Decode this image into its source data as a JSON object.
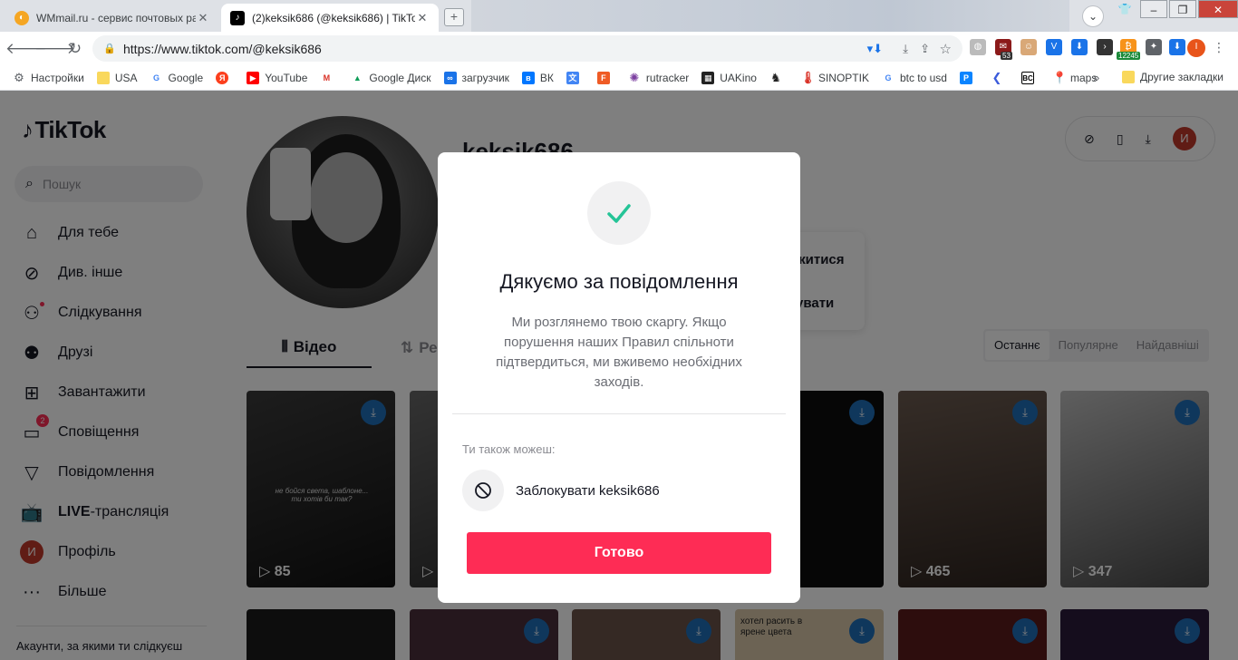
{
  "browser": {
    "tabs": [
      {
        "title": "WMmail.ru - сервис почтовых ра",
        "active": false
      },
      {
        "title": "(2)keksik686 (@keksik686) | TikTok",
        "active": true
      }
    ],
    "address": "https://www.tiktok.com/@keksik686",
    "extension_badges": {
      "mail_count": "53",
      "price": "12245"
    },
    "profile_initial": "I",
    "bookmarks": [
      "Настройки",
      "USA",
      "Google",
      "Я",
      "YouTube",
      "Google Диск",
      "загрузчик",
      "ВК",
      "rutracker",
      "UAKino",
      "SINOPTIK",
      "btc to usd",
      "maps"
    ],
    "bookmarks_more": "»",
    "bookmarks_other": "Другие закладки"
  },
  "tiktok": {
    "logo": "TikTok",
    "search_placeholder": "Пошук",
    "nav": [
      {
        "label": "Для тебе",
        "icon": "home-icon"
      },
      {
        "label": "Див. інше",
        "icon": "compass-icon"
      },
      {
        "label": "Слідкування",
        "icon": "following-icon"
      },
      {
        "label": "Друзі",
        "icon": "friends-icon"
      },
      {
        "label": "Завантажити",
        "icon": "upload-icon"
      },
      {
        "label": "Сповіщення",
        "icon": "inbox-icon",
        "badge": "2"
      },
      {
        "label": "Повідомлення",
        "icon": "send-icon"
      },
      {
        "label": "LIVE-трансляція",
        "label_bold": "LIVE",
        "label_rest": "-трансляція",
        "icon": "live-icon"
      },
      {
        "label": "Профіль",
        "icon": "avatar-icon"
      },
      {
        "label": "Більше",
        "icon": "more-icon"
      }
    ],
    "avatar_initial": "И",
    "sidebar_footer": "Акаунти, за якими ти слідкуєш",
    "profile": {
      "username": "keksik686",
      "follow_card": {
        "line1": "житися",
        "line2": "увати"
      }
    },
    "profile_tabs": {
      "videos": "Відео",
      "reposts": "Ре"
    },
    "sort_options": [
      "Останнє",
      "Популярне",
      "Найдавніші"
    ],
    "videos": [
      {
        "views": "85",
        "caption": "не бойся света, шаблоне... ти хотів би так?",
        "bg": "#2a2a2a"
      },
      {
        "views": "",
        "caption": "",
        "bg": "#4a4a4a"
      },
      {
        "views": "",
        "caption": "",
        "bg": "#3a3a3a"
      },
      {
        "views": "",
        "caption": "",
        "bg": "#121212"
      },
      {
        "views": "465",
        "caption": "",
        "bg": "#5a4e46"
      },
      {
        "views": "347",
        "caption": "",
        "bg": "#8a8a8a"
      }
    ],
    "videos_row2_captions": [
      "",
      "",
      "",
      "хотел расить в ярене цвета",
      "",
      ""
    ]
  },
  "modal": {
    "title": "Дякуємо за повідомлення",
    "body": "Ми розглянемо твою скаргу. Якщо порушення наших Правил спільноти підтвердиться, ми вживемо необхідних заходів.",
    "also_label": "Ти також можеш:",
    "block_label": "Заблокувати keksik686",
    "done_label": "Готово",
    "accent": "#fe2c55",
    "check_color": "#25c497"
  }
}
